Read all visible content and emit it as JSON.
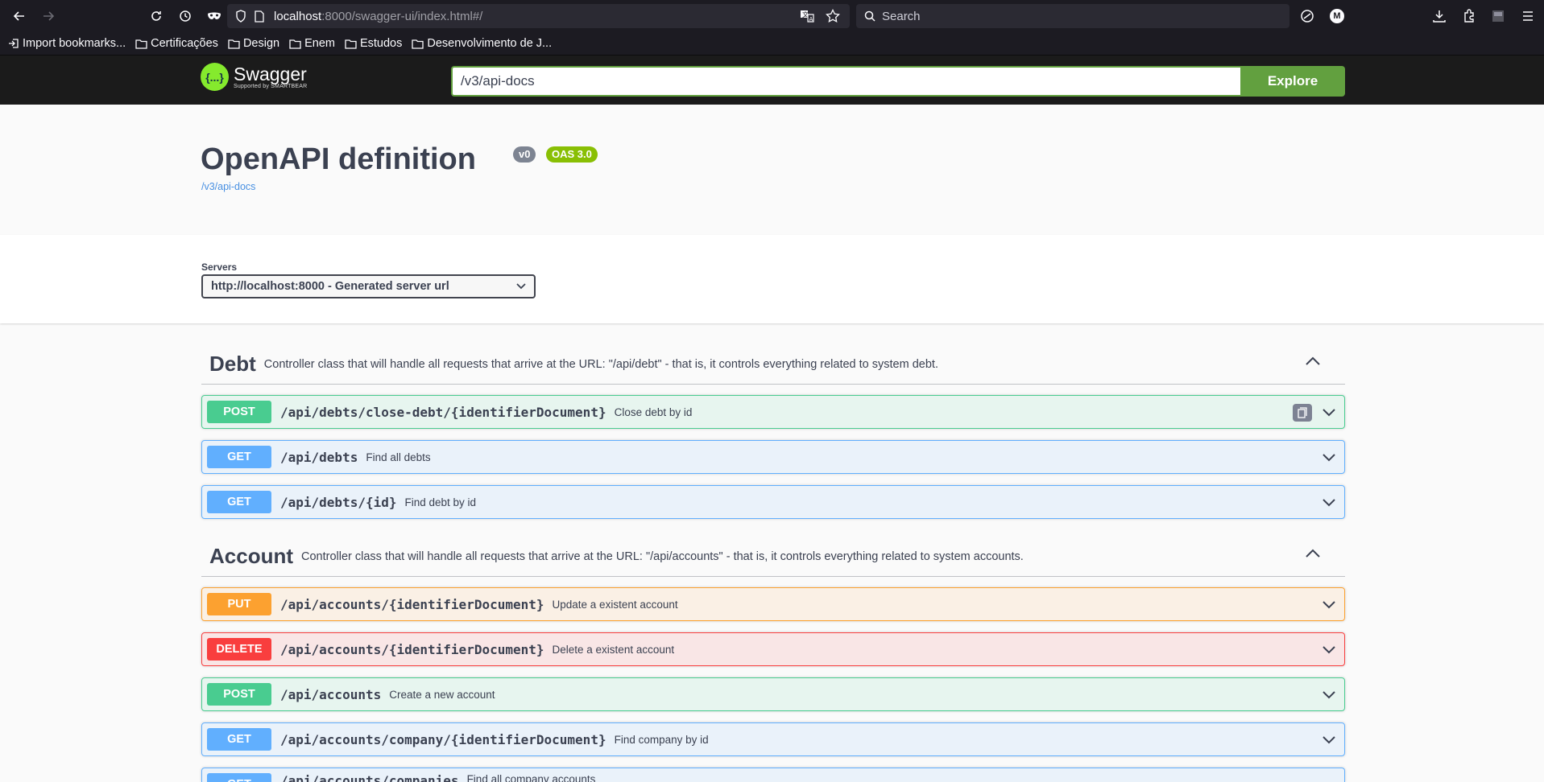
{
  "browser": {
    "url_host": "localhost",
    "url_rest": ":8000/swagger-ui/index.html#/",
    "search_placeholder": "Search",
    "profile_initial": "M",
    "bookmarks": [
      {
        "label": "Import bookmarks..."
      },
      {
        "label": "Certificações"
      },
      {
        "label": "Design"
      },
      {
        "label": "Enem"
      },
      {
        "label": "Estudos"
      },
      {
        "label": "Desenvolvimento de J..."
      }
    ]
  },
  "topbar": {
    "logo_name": "Swagger",
    "logo_sub": "Supported by SMARTBEAR",
    "logo_mark": "{...}",
    "explore_value": "/v3/api-docs",
    "explore_label": "Explore"
  },
  "info": {
    "title": "OpenAPI definition",
    "version": "v0",
    "oas": "OAS 3.0",
    "spec_link": "/v3/api-docs"
  },
  "servers": {
    "label": "Servers",
    "selected": "http://localhost:8000 - Generated server url"
  },
  "tags": [
    {
      "name": "Debt",
      "description": "Controller class that will handle all requests that arrive at the URL: \"/api/debt\" - that is, it controls everything related to system debt.",
      "operations": [
        {
          "method": "POST",
          "path": "/api/debts/close-debt/{identifierDocument}",
          "summary": "Close debt by id"
        },
        {
          "method": "GET",
          "path": "/api/debts",
          "summary": "Find all debts"
        },
        {
          "method": "GET",
          "path": "/api/debts/{id}",
          "summary": "Find debt by id"
        }
      ]
    },
    {
      "name": "Account",
      "description": "Controller class that will handle all requests that arrive at the URL: \"/api/accounts\" - that is, it controls everything related to system accounts.",
      "operations": [
        {
          "method": "PUT",
          "path": "/api/accounts/{identifierDocument}",
          "summary": "Update a existent account"
        },
        {
          "method": "DELETE",
          "path": "/api/accounts/{identifierDocument}",
          "summary": "Delete a existent account"
        },
        {
          "method": "POST",
          "path": "/api/accounts",
          "summary": "Create a new account"
        },
        {
          "method": "GET",
          "path": "/api/accounts/company/{identifierDocument}",
          "summary": "Find company by id"
        },
        {
          "method": "GET",
          "path": "/api/accounts/companies",
          "summary": "Find all company accounts"
        }
      ]
    }
  ],
  "colors": {
    "post": "#49cc90",
    "get": "#61affe",
    "put": "#fca130",
    "delete": "#f93e3e",
    "explore": "#62a03f"
  }
}
